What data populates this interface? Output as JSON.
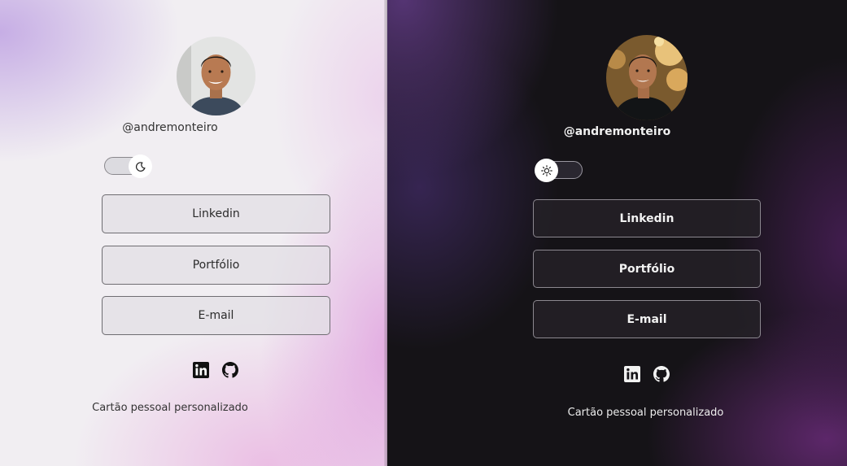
{
  "light_card": {
    "username": "@andremonteiro",
    "theme_toggle": {
      "state": "light",
      "icon": "moon-icon"
    },
    "buttons": [
      "Linkedin",
      "Portfólio",
      "E-mail"
    ],
    "social": [
      "linkedin-icon",
      "github-icon"
    ],
    "footer": "Cartão pessoal personalizado"
  },
  "dark_card": {
    "username": "@andremonteiro",
    "theme_toggle": {
      "state": "dark",
      "icon": "sun-icon"
    },
    "buttons": [
      "Linkedin",
      "Portfólio",
      "E-mail"
    ],
    "social": [
      "linkedin-icon",
      "github-icon"
    ],
    "footer": "Cartão pessoal personalizado"
  },
  "colors": {
    "light_bg": "#f1eef2",
    "light_accent": "#de96dc",
    "dark_bg": "#151317",
    "dark_accent": "#60286e"
  }
}
